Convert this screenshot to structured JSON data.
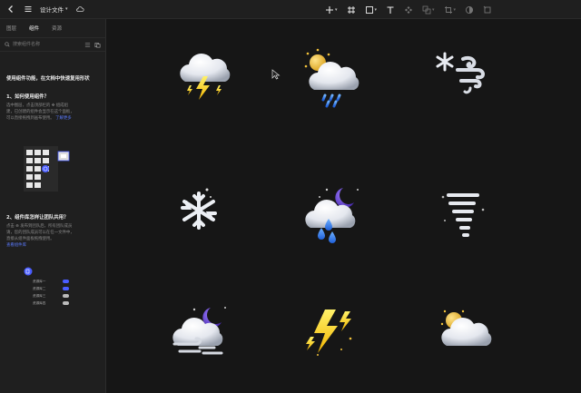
{
  "topbar": {
    "file_title": "设计文件",
    "icons": [
      "back-chevron-icon",
      "menu-icon",
      "cloud-icon",
      "plus-icon",
      "frame-icon",
      "rectangle-icon",
      "text-icon",
      "component-icon",
      "boolean-icon",
      "crop-icon",
      "mask-icon",
      "slice-icon"
    ]
  },
  "sidebar": {
    "tabs": [
      {
        "label": "图层",
        "active": false
      },
      {
        "label": "组件",
        "active": true
      },
      {
        "label": "资源",
        "active": false
      }
    ],
    "search": {
      "placeholder": "搜索组件名称"
    },
    "intro": "使用组件功能，在文档中快速复用形状",
    "section1": {
      "title": "1、如何使用组件？",
      "body_line1": "选中图层，点击顶部栏的 ✥ 组成组",
      "body_line2": "建，已创建的组件会显示在这个面板，",
      "body_line3": "可以直接拖拽到画布使用。",
      "link": "了解更多"
    },
    "section2": {
      "title": "2、组件库怎样让团队共用？",
      "body_line1": "点击 ⊕ 发布到团队后，所有团队成员",
      "body_line2": "请，您的团队成员可以在任一文件中，",
      "body_line3": "直接从组件面板拖拽使用。",
      "link": "查看组件库"
    },
    "library_items": [
      "资源库一",
      "资源库二",
      "资源库三",
      "资源库四"
    ],
    "library_toggles": [
      true,
      true,
      false,
      false
    ]
  },
  "canvas": {
    "icons": [
      {
        "name": "thunderstorm-icon"
      },
      {
        "name": "sun-cloud-rain-icon"
      },
      {
        "name": "snow-wind-icon"
      },
      {
        "name": "snowflake-icon"
      },
      {
        "name": "night-rain-icon"
      },
      {
        "name": "tornado-icon"
      },
      {
        "name": "night-fog-icon"
      },
      {
        "name": "lightning-icon"
      },
      {
        "name": "sun-cloud-rain-light-icon"
      }
    ]
  },
  "colors": {
    "accent": "#4a5dff",
    "background": "#161616",
    "panel": "#1f1f1f",
    "bolt": "#ffd21a",
    "moon": "#6a4ad6",
    "sun": "#f2c23a",
    "rain": "#2f7ef0"
  }
}
